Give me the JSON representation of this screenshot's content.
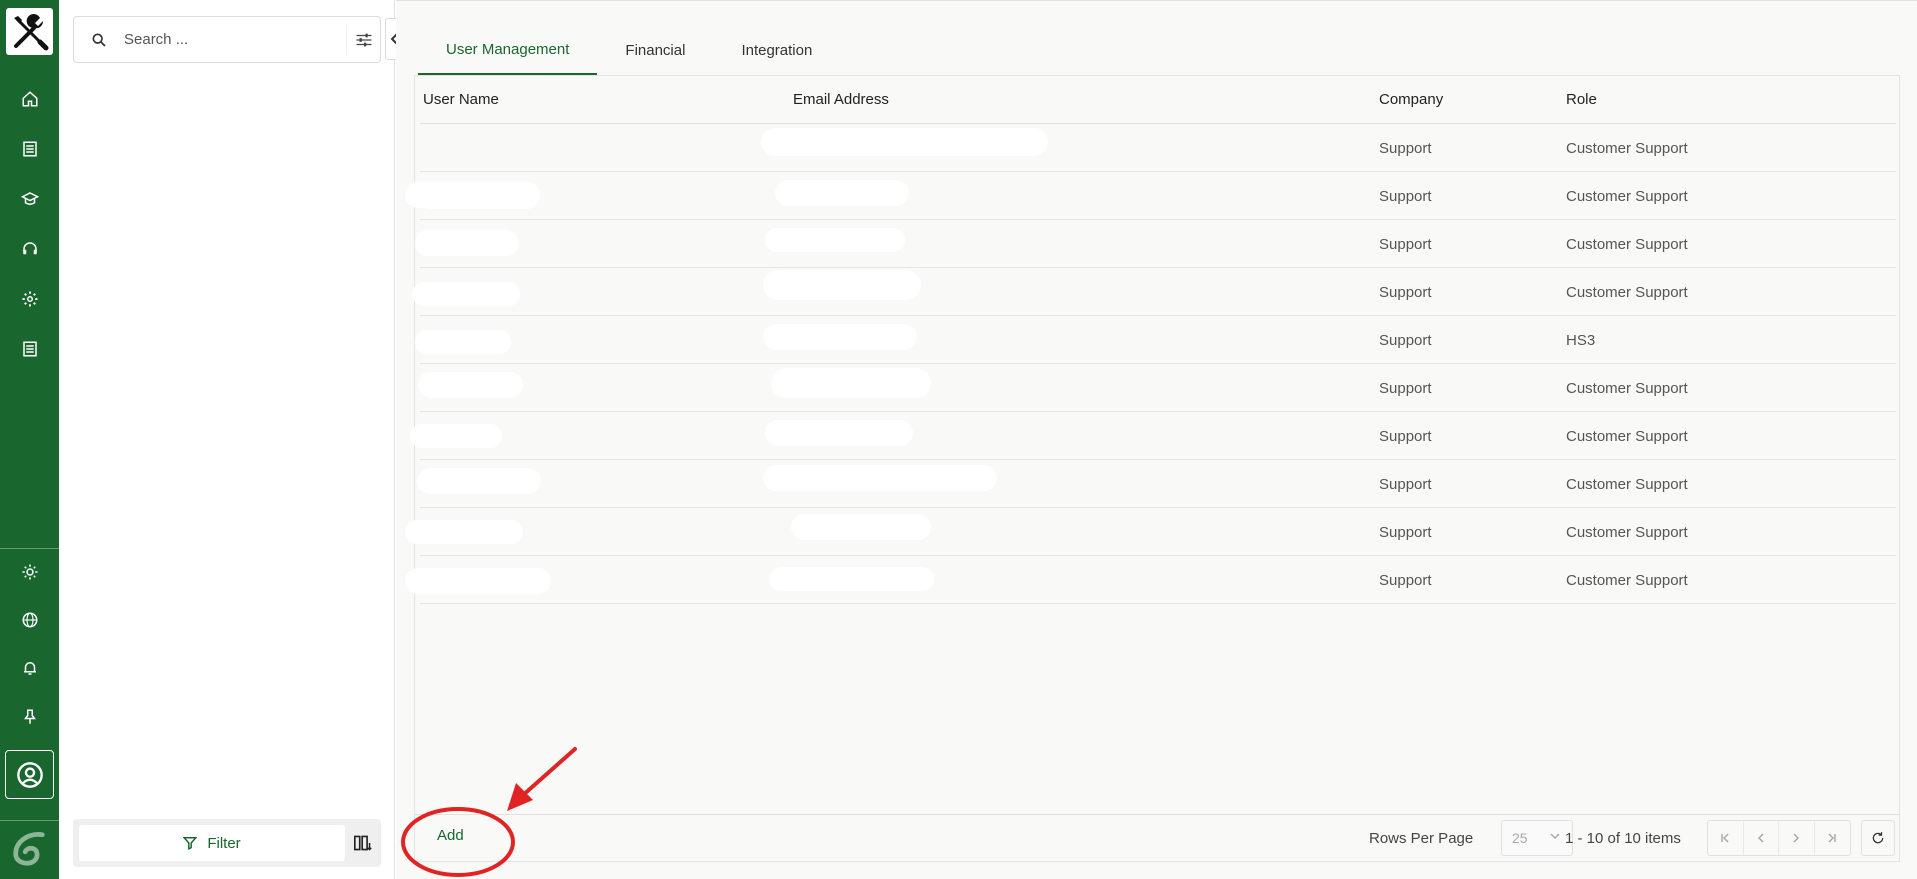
{
  "search": {
    "placeholder": "Search ..."
  },
  "filter": {
    "label": "Filter"
  },
  "tabs": [
    {
      "label": "User Management",
      "active": true
    },
    {
      "label": "Financial",
      "active": false
    },
    {
      "label": "Integration",
      "active": false
    }
  ],
  "table": {
    "columns": [
      "User Name",
      "Email Address",
      "Company",
      "Role"
    ],
    "rows": [
      {
        "company": "Support",
        "role": "Customer Support"
      },
      {
        "company": "Support",
        "role": "Customer Support"
      },
      {
        "company": "Support",
        "role": "Customer Support"
      },
      {
        "company": "Support",
        "role": "Customer Support"
      },
      {
        "company": "Support",
        "role": "HS3"
      },
      {
        "company": "Support",
        "role": "Customer Support"
      },
      {
        "company": "Support",
        "role": "Customer Support"
      },
      {
        "company": "Support",
        "role": "Customer Support"
      },
      {
        "company": "Support",
        "role": "Customer Support"
      },
      {
        "company": "Support",
        "role": "Customer Support"
      }
    ]
  },
  "footer": {
    "add_label": "Add",
    "rows_per_page_label": "Rows Per Page",
    "rows_per_page_value": "25",
    "range_text": "1 - 10 of 10 items"
  },
  "nav_icons": [
    "home-icon",
    "list-icon",
    "graduation-cap-icon",
    "headset-icon",
    "settings-icon",
    "document-icon",
    "sun-icon",
    "globe-icon",
    "bell-icon",
    "pin-icon",
    "user-circle-icon"
  ],
  "colors": {
    "brand_green": "#19662f",
    "annotation_red": "#e02424"
  }
}
